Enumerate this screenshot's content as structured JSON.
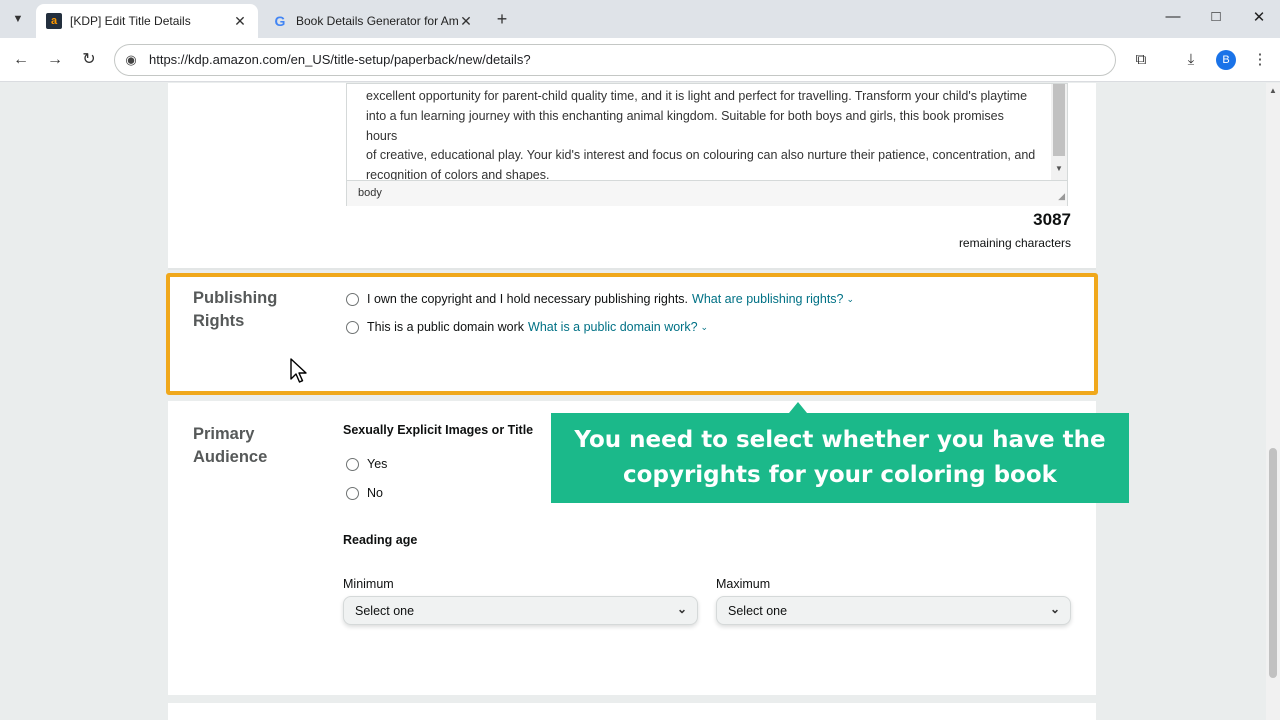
{
  "browser": {
    "tabs": [
      {
        "title": "[KDP] Edit Title Details",
        "active": true,
        "favicon": "amazon-icon"
      },
      {
        "title": "Book Details Generator for Ama",
        "active": false,
        "favicon": "google-icon"
      }
    ],
    "url": "https://kdp.amazon.com/en_US/title-setup/paperback/new/details?",
    "profile_initial": "B"
  },
  "description_editor": {
    "lines": [
      "excellent opportunity for parent-child quality time, and it is light and perfect for travelling. Transform your child's playtime",
      "into a fun learning journey with this enchanting animal kingdom. Suitable for both boys and girls, this book promises hours",
      "of creative, educational play. Your kid's interest and focus on colouring can also nurture their patience, concentration, and",
      "recognition of colors and shapes."
    ],
    "status_path": "body",
    "remaining_count": "3087",
    "remaining_label": "remaining characters"
  },
  "publishing_rights": {
    "title": "Publishing Rights",
    "options": [
      {
        "label": "I own the copyright and I hold necessary publishing rights.",
        "help": "What are publishing rights?"
      },
      {
        "label": "This is a public domain work",
        "help": "What is a public domain work?"
      }
    ]
  },
  "primary_audience": {
    "title": "Primary Audience",
    "explicit_label": "Sexually Explicit Images or Title",
    "explicit_options": [
      "Yes",
      "No"
    ],
    "reading_age_label": "Reading age",
    "minimum_label": "Minimum",
    "maximum_label": "Maximum",
    "minimum_value": "Select one",
    "maximum_value": "Select one"
  },
  "callout": {
    "text": "You need to select whether you have the copyrights for your coloring book",
    "color": "#1bb98a"
  },
  "colors": {
    "highlight_border": "#f0a81c",
    "link": "#007185"
  }
}
